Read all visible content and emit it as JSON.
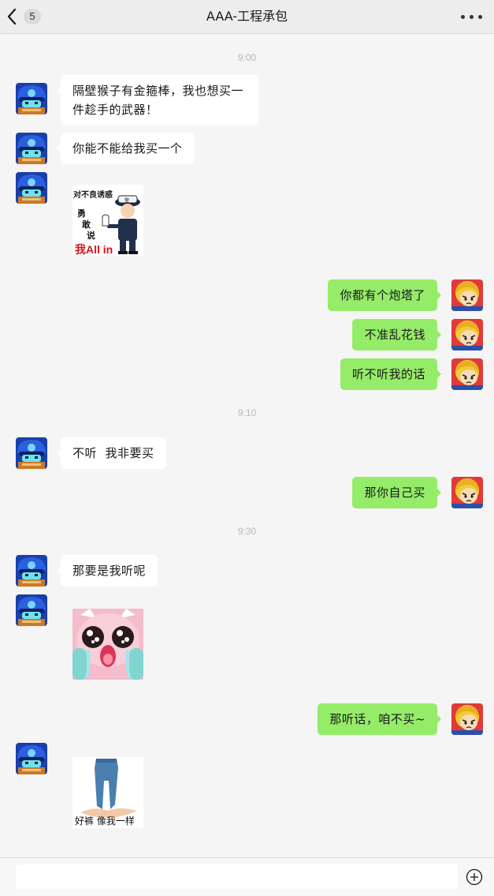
{
  "header": {
    "title": "AAA-工程承包",
    "unread_count": "5",
    "back_icon": "chevron-left-icon",
    "more_icon": "more-dots-icon"
  },
  "messages": {
    "times": [
      "9:00",
      "9:10",
      "9:30"
    ],
    "m1": "隔壁猴子有金箍棒，我也想买一件趁手的武器！",
    "m2": "你能不能给我买一个",
    "m4": "你都有个炮塔了",
    "m5": "不准乱花钱",
    "m6": "听不听我的话",
    "m7": "不听  我非要买",
    "m8": "那你自己买",
    "m9": "那要是我听呢",
    "m11": "那听话，咱不买~"
  },
  "stickers": {
    "police": {
      "line1": "对不良诱惑",
      "line2": "勇",
      "line3": "敢",
      "line4": "说",
      "line5": "我All in",
      "badge": "警"
    },
    "jeans": {
      "caption": "好裤 像我一样"
    }
  },
  "input": {
    "value": "",
    "placeholder": "",
    "plus_icon": "plus-circle-icon"
  },
  "colors": {
    "background": "#f5f5f5",
    "header": "#ededed",
    "bubble_self": "#95ec69",
    "bubble_other": "#ffffff",
    "time_text": "#b8b8b8"
  }
}
